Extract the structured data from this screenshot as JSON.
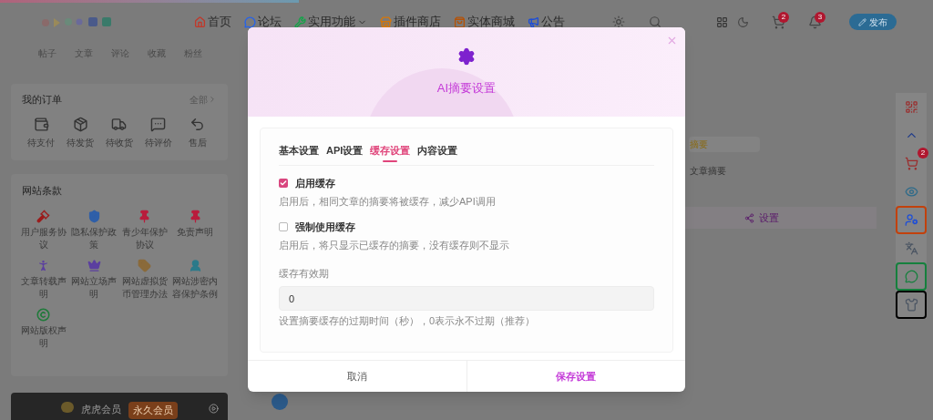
{
  "top_progress": {
    "level": 0.32
  },
  "header": {
    "nav": [
      {
        "label": "首页",
        "dropdown": false
      },
      {
        "label": "论坛",
        "dropdown": false
      },
      {
        "label": "实用功能",
        "dropdown": true
      },
      {
        "label": "插件商店",
        "dropdown": false
      },
      {
        "label": "实体商城",
        "dropdown": false
      },
      {
        "label": "公告",
        "dropdown": false
      }
    ],
    "cart_badge": "2",
    "bell_badge": "3",
    "publish_button": "发布"
  },
  "profile_stats": [
    "帖子",
    "文章",
    "评论",
    "收藏",
    "粉丝"
  ],
  "orders": {
    "title": "我的订单",
    "more": "全部",
    "items": [
      {
        "label": "待支付"
      },
      {
        "label": "待发货"
      },
      {
        "label": "待收货"
      },
      {
        "label": "待评价"
      },
      {
        "label": "售后"
      }
    ]
  },
  "terms": {
    "title": "网站条款",
    "items": [
      {
        "label": "用户服务协议"
      },
      {
        "label": "隐私保护政策"
      },
      {
        "label": "青少年保护协议"
      },
      {
        "label": "免责声明"
      },
      {
        "label": "文章转载声明"
      },
      {
        "label": "网站立场声明"
      },
      {
        "label": "网站虚拟货币管理办法"
      },
      {
        "label": "网站涉密内容保护条例"
      },
      {
        "label": "网站版权声明"
      }
    ]
  },
  "vip": {
    "title": "虎虎会员",
    "badge": "永久会员"
  },
  "background_content": {
    "summary_tab": "摘要",
    "summary_text": "文章摘要",
    "settings_button": "设置"
  },
  "side_toolbar": {
    "cart_badge": "2"
  },
  "modal": {
    "title": "AI摘要设置",
    "tabs": [
      {
        "label": "基本设置",
        "selected": false
      },
      {
        "label": "API设置",
        "selected": false
      },
      {
        "label": "缓存设置",
        "selected": true
      },
      {
        "label": "内容设置",
        "selected": false
      }
    ],
    "options": [
      {
        "label": "启用缓存",
        "checked": true,
        "hint": "启用后，相同文章的摘要将被缓存，减少API调用"
      },
      {
        "label": "强制使用缓存",
        "checked": false,
        "hint": "启用后，将只显示已缓存的摘要，没有缓存则不显示"
      }
    ],
    "field": {
      "label": "缓存有效期",
      "value": "0",
      "help": "设置摘要缓存的过期时间（秒），0表示永不过期（推荐）"
    },
    "buttons": {
      "cancel": "取消",
      "save": "保存设置"
    }
  }
}
